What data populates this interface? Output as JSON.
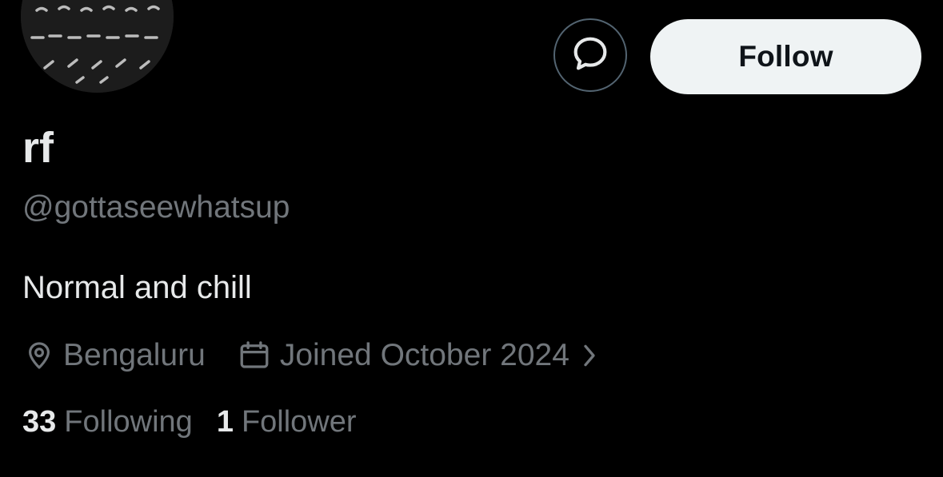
{
  "profile": {
    "display_name": "rf",
    "handle": "@gottaseewhatsup",
    "bio": "Normal and chill",
    "location": "Bengaluru",
    "joined": "Joined October 2024"
  },
  "actions": {
    "message_icon": "message-bubble-icon",
    "follow_label": "Follow"
  },
  "icons": {
    "location": "location-pin-icon",
    "calendar": "calendar-icon",
    "chevron": "chevron-right-icon"
  },
  "stats": {
    "following_count": "33",
    "following_label": "Following",
    "followers_count": "1",
    "followers_label": "Follower"
  },
  "colors": {
    "background": "#000000",
    "primary_text": "#e7e9ea",
    "secondary_text": "#71767b",
    "follow_button_bg": "#eff3f4",
    "follow_button_text": "#0f1419",
    "border": "#536471"
  }
}
